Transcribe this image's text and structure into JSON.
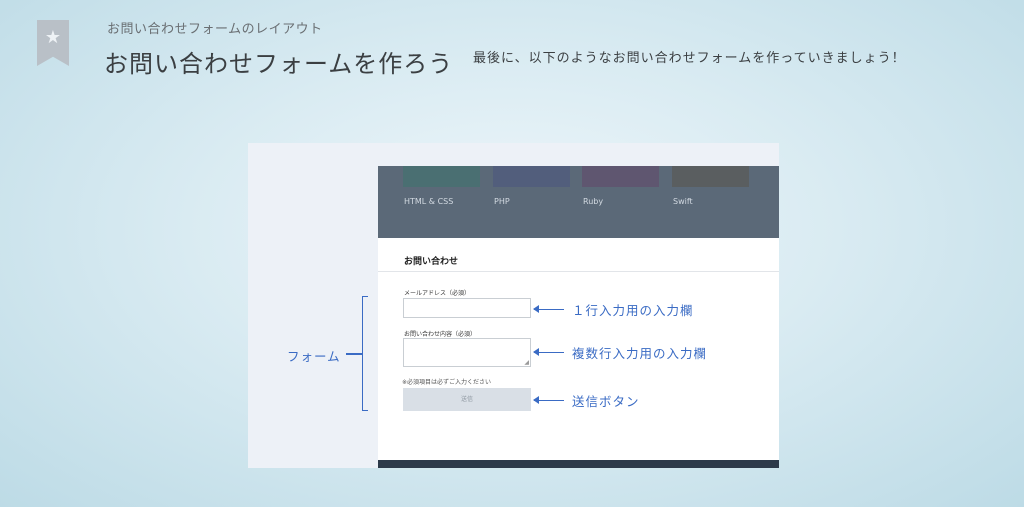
{
  "header": {
    "subtitle": "お問い合わせフォームのレイアウト",
    "title": "お問い合わせフォームを作ろう",
    "intro": "最後に、以下のようなお問い合わせフォームを作っていきましょう！",
    "bookmark_icon": "star-icon"
  },
  "preview": {
    "languages": [
      {
        "label": "HTML & CSS",
        "color": "#4a6f72"
      },
      {
        "label": "PHP",
        "color": "#525e7c"
      },
      {
        "label": "Ruby",
        "color": "#5f5670"
      },
      {
        "label": "Swift",
        "color": "#5a5e60"
      }
    ],
    "form_title": "お問い合わせ",
    "email_label": "メールアドレス（必須）",
    "content_label": "お問い合わせ内容（必須）",
    "required_note": "※必須項目は必ずご入力ください",
    "submit_label": "送信"
  },
  "annotations": {
    "single_line": "１行入力用の入力欄",
    "multi_line": "複数行入力用の入力欄",
    "submit": "送信ボタン",
    "form": "フォーム"
  },
  "colors": {
    "accent": "#3a6bc4",
    "header_bg": "#5b6978",
    "footer_bg": "#2d3a4a"
  }
}
